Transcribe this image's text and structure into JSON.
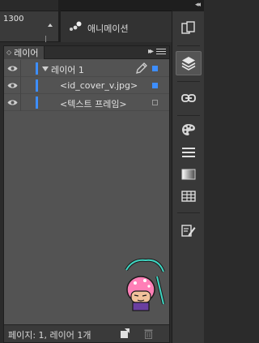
{
  "ruler": {
    "value": "1300"
  },
  "animation_panel": {
    "label": "애니메이션"
  },
  "dock": {
    "collapse_label": "◂◂",
    "icons": [
      "pages-icon",
      "layers-icon",
      "links-icon",
      "swatches-icon",
      "stroke-icon",
      "gradient-icon",
      "table-icon",
      "edit-icon"
    ]
  },
  "layers_panel": {
    "tab_label": "레이어",
    "tab_arrows": "◇",
    "expand_label": "▸▸",
    "rows": [
      {
        "name": "레이어 1",
        "type": "layer",
        "visible": true,
        "expanded": true,
        "selected_marker": "filled"
      },
      {
        "name": "<id_cover_v.jpg>",
        "type": "object",
        "visible": true,
        "selected_marker": "filled"
      },
      {
        "name": "<텍스트 프레임>",
        "type": "object",
        "visible": true,
        "selected_marker": "hollow"
      }
    ],
    "status": "페이지: 1, 레이어 1개",
    "colors": {
      "layer_color": "#3d8eff",
      "panel_bg": "#535353"
    }
  }
}
